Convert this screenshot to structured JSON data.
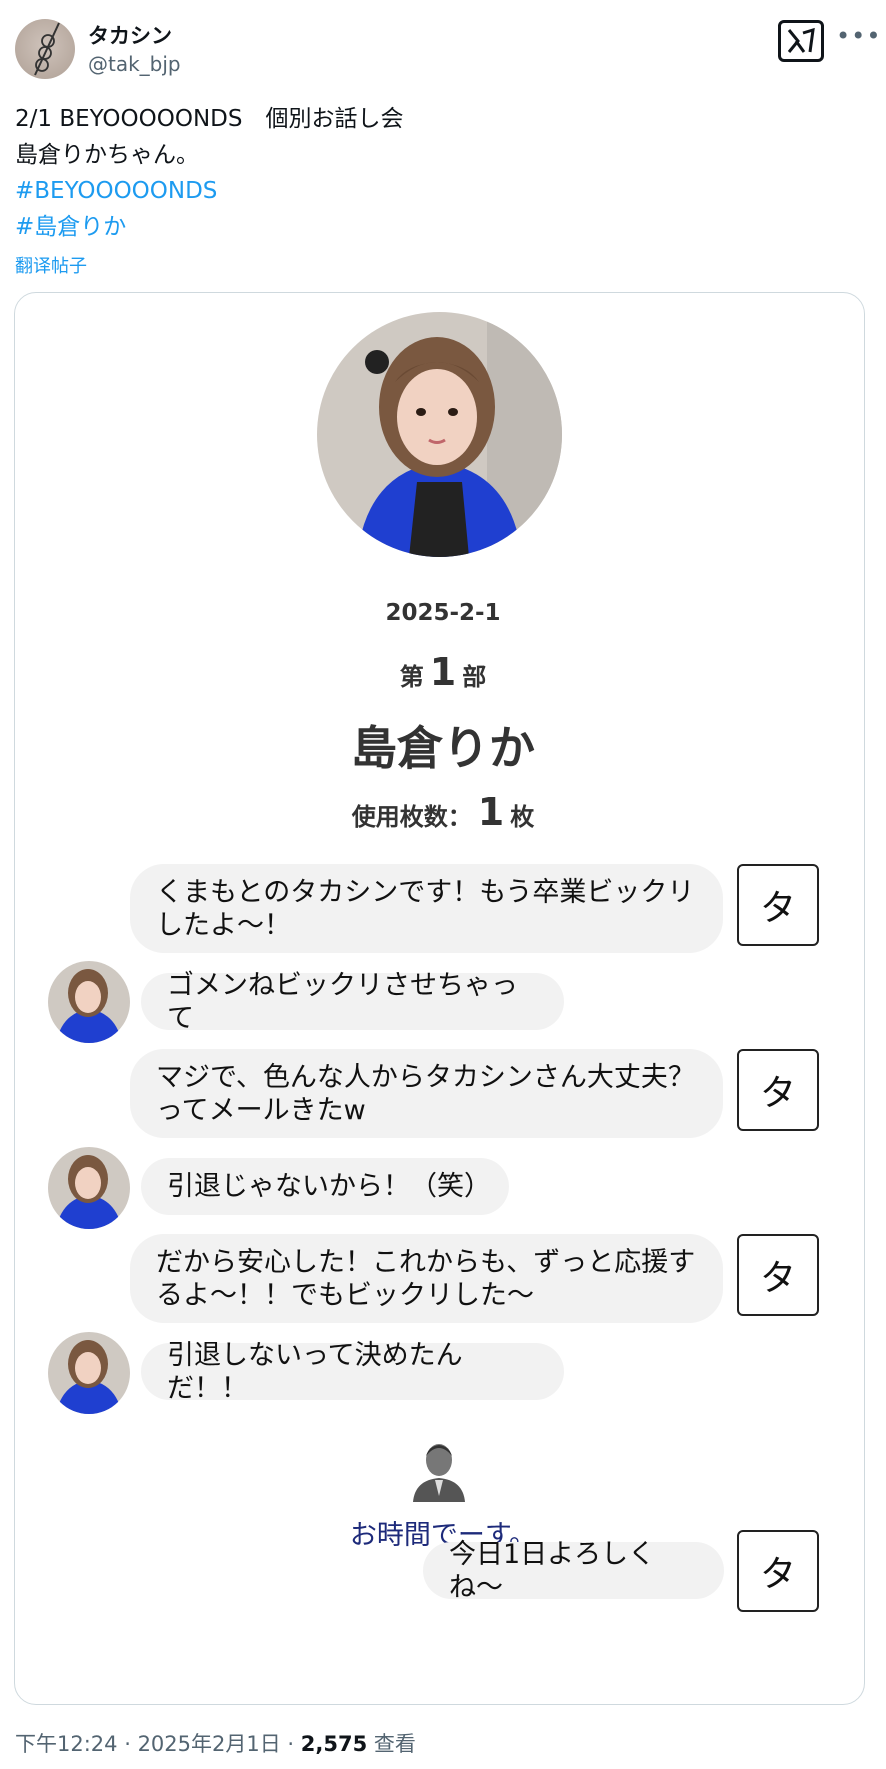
{
  "author": {
    "display_name": "タカシン",
    "handle": "@tak_bjp"
  },
  "tweet": {
    "lines": [
      "2/1 BEYOOOOONDS　個別お話し会",
      "島倉りかちゃん。"
    ],
    "hashtags": [
      "#BEYOOOOONDS",
      "#島倉りか"
    ],
    "translate_label": "翻译帖子"
  },
  "card": {
    "date": "2025-2-1",
    "session_prefix": "第",
    "session_number": "1",
    "session_suffix": "部",
    "member_name": "島倉りか",
    "tickets_label": "使用枚数：",
    "tickets_number": "1",
    "tickets_suffix": "枚",
    "user_initial": "タ",
    "chat": [
      {
        "from": "user",
        "text": "くまもとのタカシンです！もう卒業ビックリしたよ〜！"
      },
      {
        "from": "member",
        "text": "ゴメンねビックリさせちゃって"
      },
      {
        "from": "user",
        "text": "マジで、色んな人からタカシンさん大丈夫？ってメールきたw"
      },
      {
        "from": "member",
        "text": "引退じゃないから！（笑）"
      },
      {
        "from": "user",
        "text": "だから安心した！これからも、ずっと応援するよ〜！！でもビックリした〜"
      },
      {
        "from": "member",
        "text": "引退しないって決めたんだ！！"
      },
      {
        "from": "staff",
        "text": "お時間でーす。"
      },
      {
        "from": "user",
        "text": "今日1日よろしくね〜"
      }
    ]
  },
  "meta": {
    "time": "下午12:24",
    "date": "2025年2月1日",
    "views": "2,575",
    "views_label": "查看"
  },
  "icons": {
    "x_logo": "x-logo-icon",
    "more": "more-icon",
    "staff": "staff-person-icon"
  },
  "colors": {
    "link": "#1d9bf0",
    "staff_text": "#1d2a7a",
    "bubble": "#f2f2f2"
  }
}
